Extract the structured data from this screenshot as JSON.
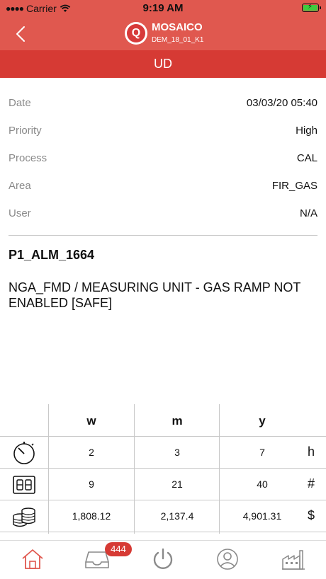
{
  "status_bar": {
    "carrier": "Carrier",
    "time": "9:19 AM"
  },
  "nav": {
    "app_name": "MOSAICO",
    "subtitle": "DEM_18_01_K1",
    "logo_letter": "Q"
  },
  "section_title": "UD",
  "details": [
    {
      "label": "Date",
      "value": "03/03/20 05:40"
    },
    {
      "label": "Priority",
      "value": "High"
    },
    {
      "label": "Process",
      "value": "CAL"
    },
    {
      "label": "Area",
      "value": "FIR_GAS"
    },
    {
      "label": "User",
      "value": "N/A"
    }
  ],
  "alarm": {
    "code": "P1_ALM_1664",
    "description": "NGA_FMD / MEASURING UNIT - GAS RAMP NOT ENABLED [SAFE]"
  },
  "stats": {
    "columns": [
      "w",
      "m",
      "y"
    ],
    "rows": [
      {
        "icon": "stopwatch-icon",
        "values": [
          "2",
          "3",
          "7"
        ],
        "unit": "h"
      },
      {
        "icon": "digital-counter-icon",
        "values": [
          "9",
          "21",
          "40"
        ],
        "unit": "#"
      },
      {
        "icon": "coins-icon",
        "values": [
          "1,808.12",
          "2,137.4",
          "4,901.31"
        ],
        "unit": "$"
      }
    ]
  },
  "tabbar": {
    "items": [
      "home-icon",
      "inbox-icon",
      "power-icon",
      "user-icon",
      "factory-icon"
    ],
    "badge": "444"
  },
  "colors": {
    "accent": "#e0584f",
    "header": "#d63a34",
    "label": "#8a8a8a"
  }
}
